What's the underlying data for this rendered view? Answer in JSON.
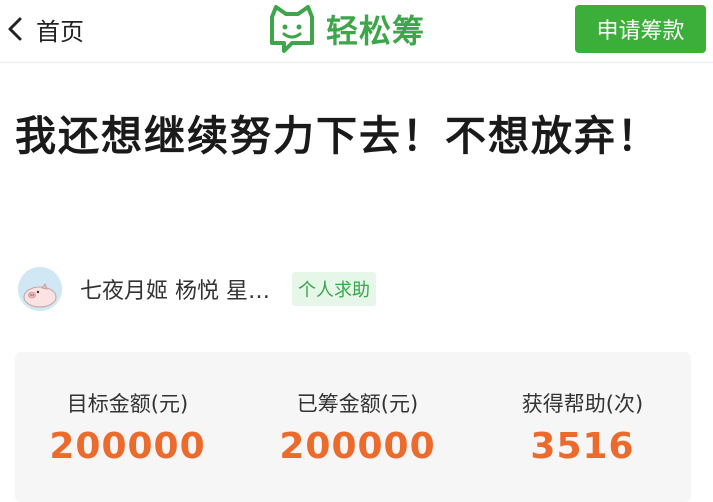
{
  "header": {
    "back_label": "首页",
    "logo_text": "轻松筹",
    "apply_button_label": "申请筹款",
    "brand_color": "#3ea64a",
    "button_color": "#3cae3a"
  },
  "project": {
    "title": "我还想继续努力下去！不想放弃！",
    "author_name": "七夜月姬 杨悦 星…",
    "tag_label": "个人求助"
  },
  "stats": [
    {
      "label": "目标金额(元)",
      "value": "200000"
    },
    {
      "label": "已筹金额(元)",
      "value": "200000"
    },
    {
      "label": "获得帮助(次)",
      "value": "3516"
    }
  ],
  "accent_color": "#ec6a2c",
  "icons": [
    "chevron-left-icon",
    "logo-cat-icon",
    "pig-avatar-icon"
  ]
}
